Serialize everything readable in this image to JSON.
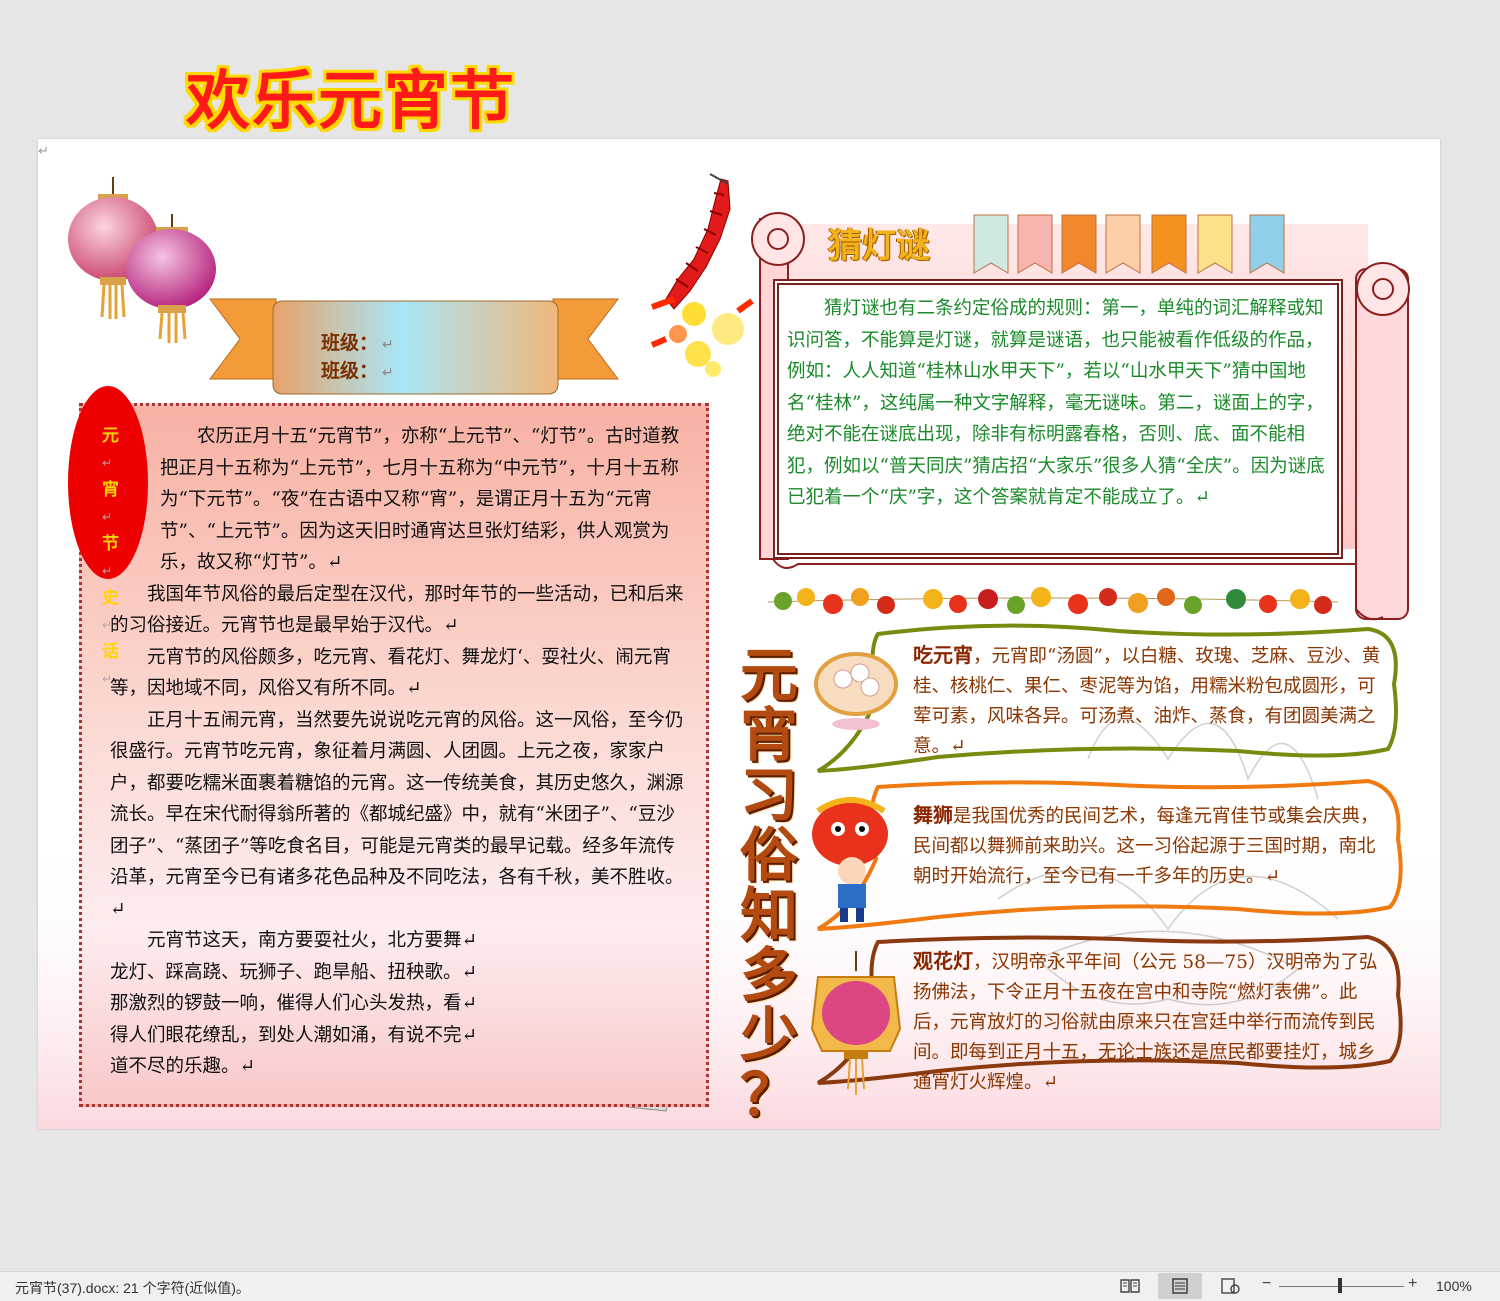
{
  "document": {
    "title": "欢乐元宵节",
    "class_labels": [
      "班级：",
      "班级："
    ],
    "paragraph_mark": "↵",
    "history": {
      "label_chars": [
        "元",
        "宵",
        "节",
        "史",
        "话"
      ],
      "paragraphs": [
        "农历正月十五“元宵节”，亦称“上元节”、“灯节”。古时道教把正月十五称为“上元节”，七月十五称为“中元节”，十月十五称为“下元节”。“夜”在古语中又称“宵”，是谓正月十五为“元宵节”、“上元节”。因为这天旧时通宵达旦张灯结彩，供人观赏为乐，故又称“灯节”。↵",
        "我国年节风俗的最后定型在汉代，那时年节的一些活动，已和后来的习俗接近。元宵节也是最早始于汉代。↵",
        "元宵节的风俗颇多，吃元宵、看花灯、舞龙灯‘、耍社火、闹元宵等，因地域不同，风俗又有所不同。↵",
        "正月十五闹元宵，当然要先说说吃元宵的风俗。这一风俗，至今仍很盛行。元宵节吃元宵，象征着月满圆、人团圆。上元之夜，家家户户，都要吃糯米面裹着糖馅的元宵。这一传统美食，其历史悠久，渊源流长。早在宋代耐得翁所著的《都城纪盛》中，就有“米团子”、“豆沙团子”、“蒸团子”等吃食名目，可能是元宵类的最早记载。经多年流传沿革，元宵至今已有诸多花色品种及不同吃法，各有千秋，美不胜收。↵",
        "元宵节这天，南方要耍社火，北方要舞↵龙灯、踩高跷、玩狮子、跑旱船、扭秧歌。↵那激烈的锣鼓一响，催得人们心头发热，看↵得人们眼花缭乱，到处人潮如涌，有说不完↵道不尽的乐趣。↵"
      ]
    },
    "riddles": {
      "title": "猜灯谜",
      "text": "猜灯谜也有二条约定俗成的规则：第一，单纯的词汇解释或知识问答，不能算是灯谜，就算是谜语，也只能被看作低级的作品，例如：人人知道“桂林山水甲天下”，若以“山水甲天下”猜中国地名“桂林”，这纯属一种文字解释，毫无谜味。第二，谜面上的字，绝对不能在谜底出现，除非有标明露春格，否则、底、面不能相犯，例如以“普天同庆”猜店招“大家乐”很多人猜“全庆”。因为谜底已犯着一个“庆”字，这个答案就肯定不能成立了。↵"
    },
    "customs": {
      "vertical_title_chars": [
        "元",
        "宵",
        "习",
        "俗",
        "知",
        "多",
        "少",
        "？"
      ],
      "items": [
        {
          "name": "吃元宵",
          "text": "，元宵即“汤圆”，以白糖、玫瑰、芝麻、豆沙、黄桂、核桃仁、果仁、枣泥等为馅，用糯米粉包成圆形，可荤可素，风味各异。可汤煮、油炸、蒸食，有团圆美满之意。↵"
        },
        {
          "name": "舞狮",
          "text": "是我国优秀的民间艺术，每逢元宵佳节或集会庆典，民间都以舞狮前来助兴。这一习俗起源于三国时期，南北朝时开始流行，至今已有一千多年的历史。↵"
        },
        {
          "name": "观花灯",
          "text": "，汉明帝永平年间（公元 58—75）汉明帝为了弘扬佛法，下令正月十五夜在宫中和寺院“燃灯表佛”。此后，元宵放灯的习俗就由原来只在宫廷中举行而流传到民间。即每到正月十五，无论士族还是庶民都要挂灯，城乡通宵灯火辉煌。↵"
        }
      ]
    }
  },
  "status_bar": {
    "doc_info": "元宵节(37).docx: 21 个字符(近似值)。",
    "zoom_minus": "−",
    "zoom_plus": "+",
    "zoom_level": "100%",
    "zoom_fraction": 0.5
  },
  "colors": {
    "title": "#ff1a1a",
    "title_outline": "#ffd800",
    "history_text": "#111111",
    "riddle_text": "#1a8a2a",
    "custom_text": "#8b3500"
  },
  "icons": [
    "lantern-icon",
    "firecracker-icon",
    "flag-banner-icon",
    "leaf-garland-icon",
    "tangyuan-bowl-icon",
    "lion-dance-icon",
    "flower-lantern-icon",
    "papercut-dragon-icon",
    "read-mode-icon",
    "print-layout-icon",
    "web-layout-icon"
  ]
}
